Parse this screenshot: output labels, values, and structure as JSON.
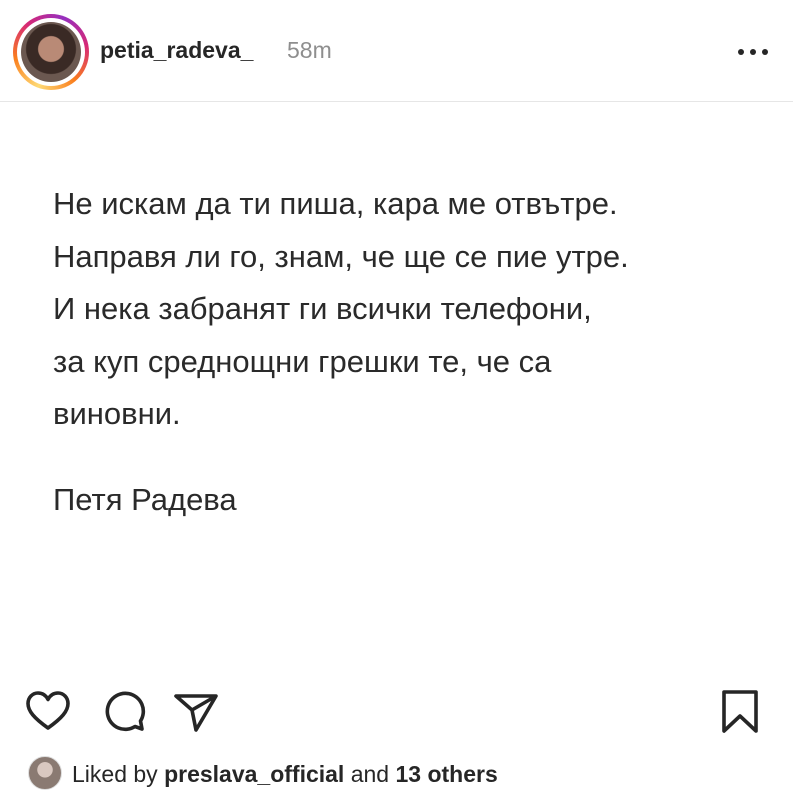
{
  "header": {
    "username": "petia_radeva_",
    "time": "58m",
    "more_icon": "more-horizontal-icon"
  },
  "post": {
    "lines": [
      "Не искам да ти пиша, кара ме отвътре.",
      "Направя ли го, знам, че ще се пие утре.",
      "И нека забранят ги всички телефони,",
      "за куп среднощни грешки те, че са",
      "виновни."
    ],
    "signature": "Петя Радева"
  },
  "actions": {
    "icons": [
      "heart-icon",
      "comment-icon",
      "share-icon",
      "bookmark-icon"
    ]
  },
  "likes": {
    "prefix": "Liked by",
    "user": "preslava_official",
    "middle": "and",
    "others": "13 others"
  }
}
